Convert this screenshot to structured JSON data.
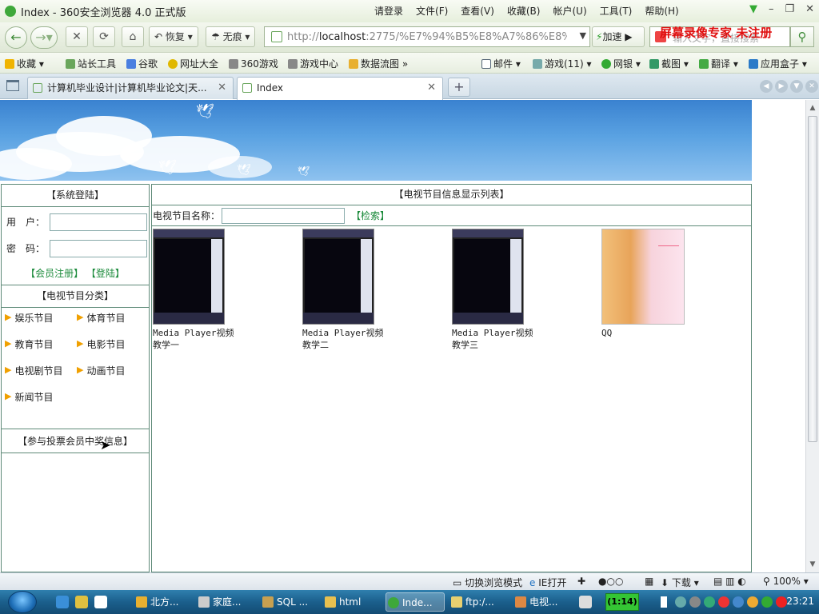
{
  "window": {
    "title": "Index - 360安全浏览器 4.0 正式版",
    "menu": [
      "请登录",
      "文件(F)",
      "查看(V)",
      "收藏(B)",
      "帐户(U)",
      "工具(T)",
      "帮助(H)"
    ]
  },
  "nav": {
    "restore": "恢复",
    "incognito": "无痕",
    "url_prefix": "http://",
    "url_host": "localhost",
    "url_rest": ":2775/%E7%94%B5%E8%A7%86%E8%",
    "speedup": "加速",
    "search_placeholder": "输入文字，直接搜索",
    "watermark": "屏幕录像专家 未注册"
  },
  "bookmarks": [
    "收藏",
    "站长工具",
    "谷歌",
    "网址大全",
    "360游戏",
    "游戏中心",
    "数据流图",
    "邮件",
    "游戏(11)",
    "网银",
    "截图",
    "翻译",
    "应用盒子"
  ],
  "tabs": [
    {
      "label": "计算机毕业设计|计算机毕业论文|天..."
    },
    {
      "label": "Index"
    }
  ],
  "page": {
    "login": {
      "header": "【系统登陆】",
      "user_label": "用　户：",
      "pass_label": "密　码：",
      "register": "【会员注册】",
      "login": "【登陆】"
    },
    "categories": {
      "header": "【电视节目分类】",
      "items": [
        "娱乐节目",
        "体育节目",
        "教育节目",
        "电影节目",
        "电视剧节目",
        "动画节目",
        "新闻节目"
      ]
    },
    "vote": {
      "header": "【参与投票会员中奖信息】"
    },
    "list": {
      "header": "【电视节目信息显示列表】",
      "search_label": "电视节目名称：",
      "search_button": "【检索】",
      "items": [
        {
          "line1": "Media Player视频",
          "line2": "教学一"
        },
        {
          "line1": "Media Player视频",
          "line2": "教学二"
        },
        {
          "line1": "Media Player视频",
          "line2": "教学三"
        },
        {
          "line1": "QQ",
          "line2": ""
        }
      ]
    }
  },
  "status": {
    "mode": "切换浏览模式",
    "ie": "IE打开",
    "download": "下载",
    "zoom": "100%"
  },
  "taskbar": {
    "items": [
      "北方...",
      "家庭...",
      "SQL ...",
      "html",
      "Inde...",
      "ftp:/...",
      "电视..."
    ],
    "timer": "(1:14)",
    "clock": "23:21"
  }
}
